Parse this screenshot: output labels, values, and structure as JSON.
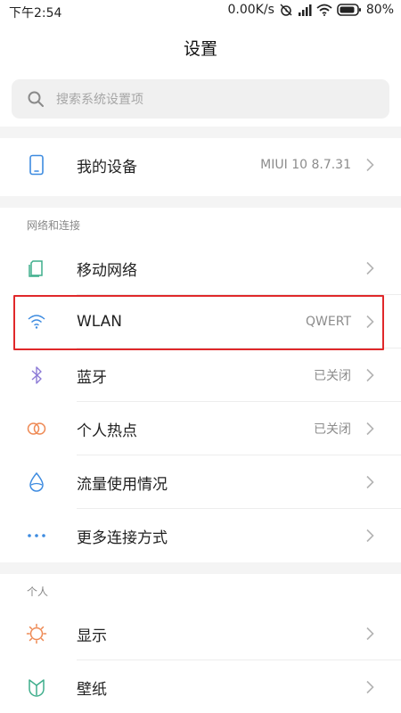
{
  "status_bar": {
    "time": "下午2:54",
    "speed": "0.00K/s",
    "battery": "80%"
  },
  "header": {
    "title": "设置"
  },
  "search": {
    "placeholder": "搜索系统设置项"
  },
  "device": {
    "label": "我的设备",
    "value": "MIUI 10 8.7.31",
    "icon": "phone-icon"
  },
  "network_section": {
    "title": "网络和连接",
    "items": [
      {
        "label": "移动网络",
        "value": "",
        "icon": "sim-card-icon"
      },
      {
        "label": "WLAN",
        "value": "QWERT",
        "icon": "wifi-icon"
      },
      {
        "label": "蓝牙",
        "value": "已关闭",
        "icon": "bluetooth-icon"
      },
      {
        "label": "个人热点",
        "value": "已关闭",
        "icon": "hotspot-icon"
      },
      {
        "label": "流量使用情况",
        "value": "",
        "icon": "data-usage-icon"
      },
      {
        "label": "更多连接方式",
        "value": "",
        "icon": "more-icon"
      }
    ]
  },
  "personal_section": {
    "title": "个人",
    "items": [
      {
        "label": "显示",
        "value": "",
        "icon": "brightness-icon"
      },
      {
        "label": "壁纸",
        "value": "",
        "icon": "wallpaper-icon"
      }
    ]
  },
  "colors": {
    "accent_blue": "#3d8be0",
    "highlight_red": "#e0282a",
    "bluetooth_purple": "#8c7ad6",
    "hotspot_orange": "#ee8a55",
    "wallpaper_green": "#3fae8c"
  }
}
